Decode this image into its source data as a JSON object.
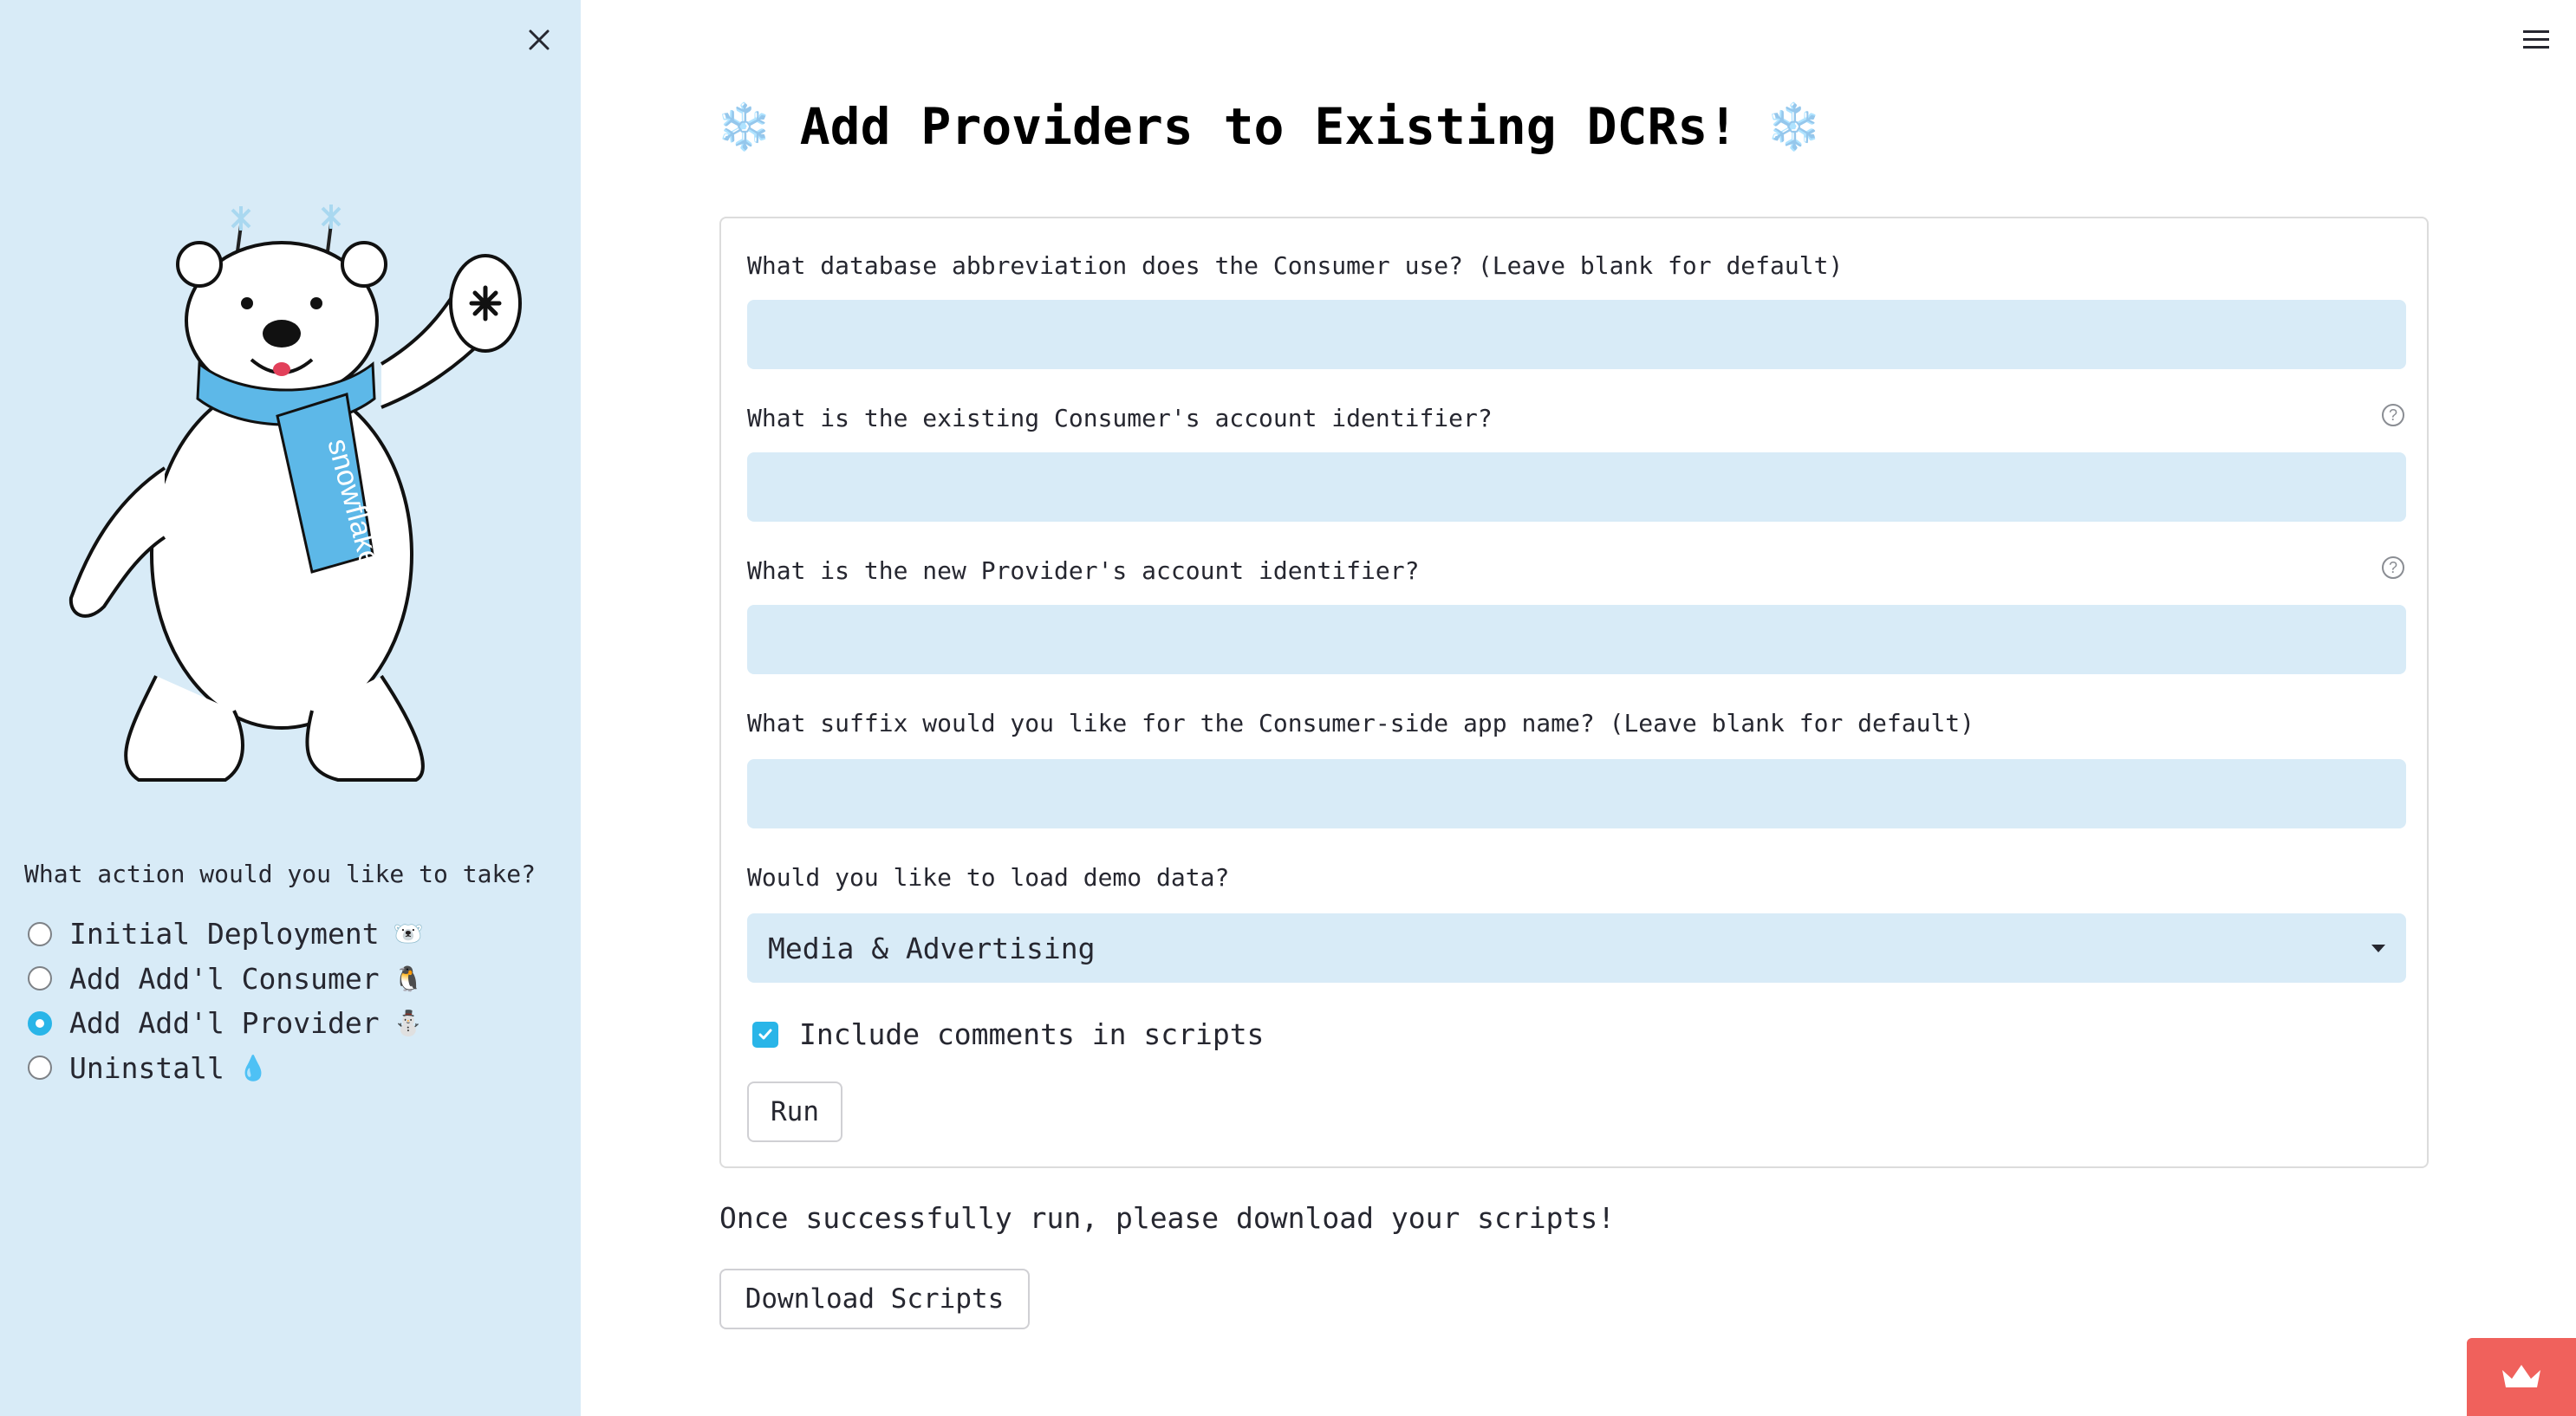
{
  "sidebar": {
    "close_icon": "close-icon",
    "mascot": "snowflake-polar-bear-mascot",
    "radio_label": "What action would you like to take?",
    "options": [
      {
        "label": "Initial Deployment",
        "emoji": "🐻‍❄️",
        "selected": false
      },
      {
        "label": "Add Add'l Consumer",
        "emoji": "🐧",
        "selected": false
      },
      {
        "label": "Add Add'l Provider",
        "emoji": "⛄",
        "selected": true
      },
      {
        "label": "Uninstall",
        "emoji": "💧",
        "selected": false
      }
    ]
  },
  "header": {
    "menu_icon": "hamburger-menu-icon"
  },
  "main": {
    "title": "Add Providers to Existing DCRs!",
    "title_emoji": "❄️",
    "fields": [
      {
        "label": "What database abbreviation does the Consumer use? (Leave blank for default)",
        "value": "",
        "help": false
      },
      {
        "label": "What is the existing Consumer's account identifier?",
        "value": "",
        "help": true
      },
      {
        "label": "What is the new Provider's account identifier?",
        "value": "",
        "help": true
      },
      {
        "label": "What suffix would you like for the Consumer-side app name? (Leave blank for default)",
        "value": "",
        "help": false
      }
    ],
    "help_glyph": "?",
    "demo_label": "Would you like to load demo data?",
    "demo_value": "Media & Advertising",
    "checkbox_label": "Include comments in scripts",
    "checkbox_checked": true,
    "run_label": "Run",
    "info_text": "Once successfully run, please download your scripts!",
    "download_label": "Download Scripts"
  },
  "badge_icon": "crown-icon",
  "colors": {
    "sidebar_bg": "#d8ebf7",
    "input_bg": "#d8ebf7",
    "accent": "#29b5e8",
    "badge": "#f0615c"
  }
}
